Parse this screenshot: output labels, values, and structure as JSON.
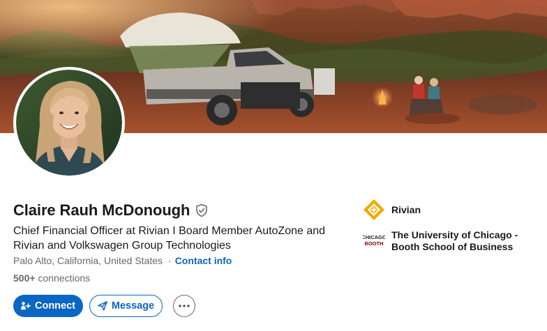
{
  "profile": {
    "name": "Claire Rauh McDonough",
    "headline": "Chief Financial Officer at Rivian I Board Member AutoZone and Rivian and Volkswagen Group Technologies",
    "location": "Palo Alto, California, United States",
    "separator": "·",
    "contact_info_label": "Contact info",
    "connections_count": "500+",
    "connections_label": "connections"
  },
  "actions": {
    "connect_label": "Connect",
    "message_label": "Message"
  },
  "organizations": [
    {
      "name": "Rivian",
      "logo_icon": "rivian-logo",
      "logo_color": "#f2a900"
    },
    {
      "name_line1": "The University of Chicago -",
      "name_line2": "Booth School of Business",
      "logo_icon": "chicago-booth-logo",
      "logo_text_line1": "CHICAGO",
      "logo_text_line2": "BOOTH"
    }
  ],
  "colors": {
    "accent": "#0a66c2",
    "text_primary": "rgba(0,0,0,0.9)",
    "text_secondary": "rgba(0,0,0,0.6)"
  }
}
